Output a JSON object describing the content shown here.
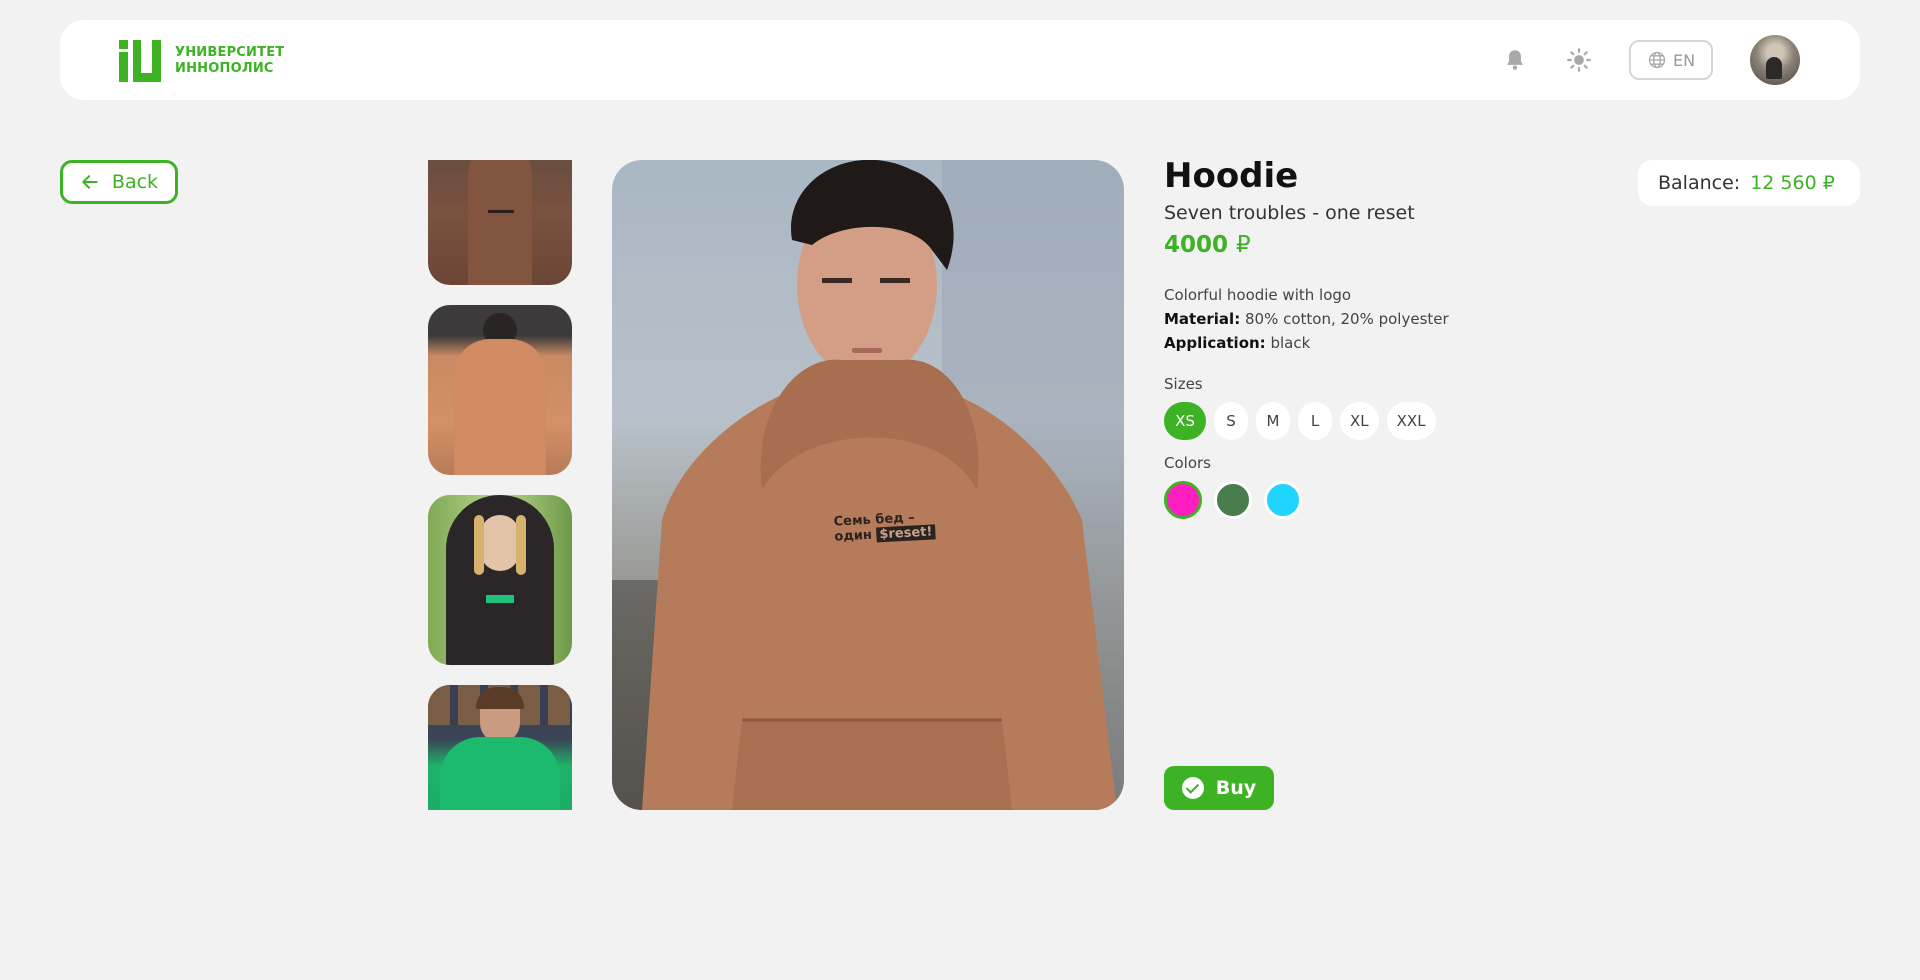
{
  "header": {
    "logo_line1": "УНИВЕРСИТЕТ",
    "logo_line2": "ИННОПОЛИС",
    "language": "EN",
    "icons": [
      "bell-icon",
      "sun-icon",
      "globe-icon"
    ]
  },
  "back_label": "Back",
  "balance": {
    "label": "Balance:",
    "value": "12 560"
  },
  "product": {
    "title": "Hoodie",
    "subtitle": "Seven troubles - one reset",
    "price": "4000",
    "description": "Colorful hoodie with logo",
    "material_label": "Material:",
    "material_value": "80% cotton, 20% polyester",
    "application_label": "Application:",
    "application_value": "black",
    "print_line1": "Семь бед –",
    "print_line2": "один",
    "print_highlight": "$reset!"
  },
  "sizes_label": "Sizes",
  "sizes": [
    "XS",
    "S",
    "M",
    "L",
    "XL",
    "XXL"
  ],
  "selected_size": "XS",
  "colors_label": "Colors",
  "colors": [
    "#ff1ec0",
    "#4a7d4e",
    "#1fd4ff"
  ],
  "selected_color": "#ff1ec0",
  "buy_label": "Buy",
  "accent_color": "#3cb224"
}
